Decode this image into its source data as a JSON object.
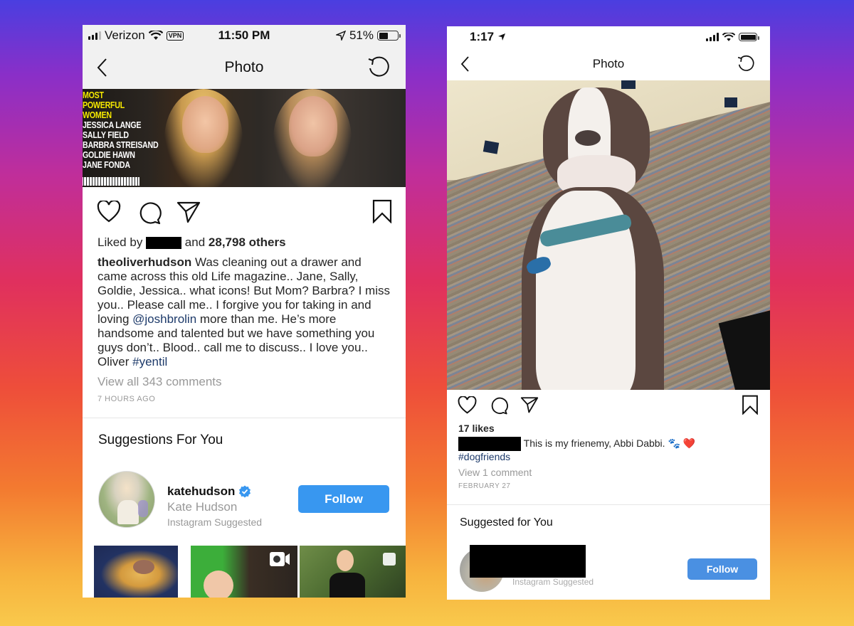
{
  "left_phone": {
    "status": {
      "carrier": "Verizon",
      "vpn_label": "VPN",
      "time": "11:50 PM",
      "battery": "51%",
      "battery_level": 0.51
    },
    "nav": {
      "title": "Photo",
      "back_icon": "chevron-left-icon",
      "refresh_icon": "refresh-icon"
    },
    "photo": {
      "magazine_lines_yellow": [
        "MOST",
        "POWERFUL",
        "WOMEN"
      ],
      "magazine_lines_white": [
        "JESSICA LANGE",
        "SALLY FIELD",
        "BARBRA STREISAND",
        "GOLDIE HAWN",
        "JANE FONDA"
      ]
    },
    "actions": {
      "like": "heart-icon",
      "comment": "comment-icon",
      "share": "send-icon",
      "save": "bookmark-icon"
    },
    "likes": {
      "prefix": "Liked by",
      "middle": "and",
      "count": "28,798 others"
    },
    "caption": {
      "username": "theoliverhudson",
      "text_1": "Was cleaning out a drawer and came across this old Life magazine.. Jane, Sally, Goldie, Jessica.. what icons!  But Mom?  Barbra? I miss you.. Please call me.. I forgive you for taking in and loving ",
      "mention": "@joshbrolin",
      "text_2": " more than me. He’s more handsome and talented but we have something you guys don’t.. Blood.. call me to discuss.. I love you.. Oliver ",
      "hashtag": "#yentil"
    },
    "view_comments": "View all 343 comments",
    "timestamp": "7 HOURS AGO",
    "suggestions": {
      "title": "Suggestions For You",
      "user": {
        "username": "katehudson",
        "verified": true,
        "full_name": "Kate Hudson",
        "reason": "Instagram Suggested",
        "follow_label": "Follow"
      },
      "thumbnails": [
        "food-photo",
        "video-photo",
        "portrait-photo"
      ]
    }
  },
  "right_phone": {
    "status": {
      "time": "1:17",
      "battery_level": 1.0
    },
    "nav": {
      "title": "Photo"
    },
    "actions": {
      "like": "heart-icon",
      "comment": "comment-icon",
      "share": "send-icon",
      "save": "bookmark-icon"
    },
    "likes": "17 likes",
    "caption": {
      "text": "This is my frienemy, Abbi Dabbi.",
      "emoji": "🐾 ❤️",
      "hashtag": "#dogfriends"
    },
    "view_comments": "View 1 comment",
    "timestamp": "FEBRUARY 27",
    "suggestions": {
      "title": "Suggested for You",
      "reason": "Instagram Suggested",
      "follow_label": "Follow"
    }
  },
  "colors": {
    "follow_blue": "#3897f0",
    "link_navy": "#1d3a6a",
    "verified_blue": "#3897f0"
  }
}
